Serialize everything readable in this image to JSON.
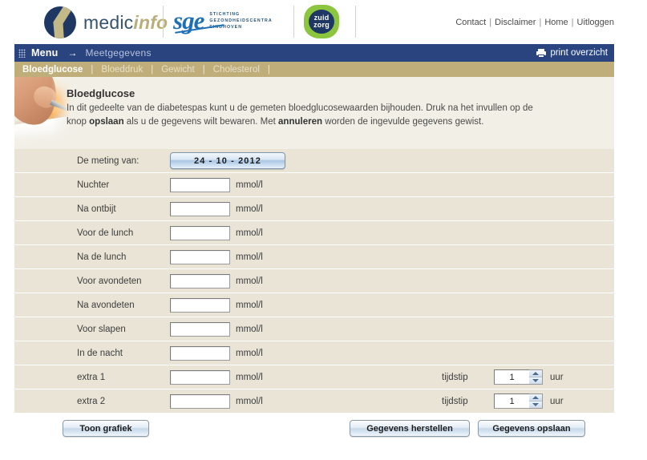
{
  "header": {
    "logos": [
      {
        "name": "medicinfo",
        "text_main": "medic",
        "text_accent": "info"
      },
      {
        "name": "sge",
        "wordmark": "sge",
        "sub_line1": "STICHTING",
        "sub_line2": "GEZONDHEIDSCENTRA",
        "sub_line3": "EINDHOVEN"
      },
      {
        "name": "zuidzorg",
        "line1": "zuid",
        "line2": "zorg"
      }
    ],
    "links": [
      "Contact",
      "Disclaimer",
      "Home",
      "Uitloggen"
    ],
    "link_separator": "|"
  },
  "navbar": {
    "menu_label": "Menu",
    "arrow": "→",
    "breadcrumb": "Meetgegevens",
    "print_label": "print overzicht"
  },
  "tabs": [
    {
      "label": "Bloedglucose",
      "active": true
    },
    {
      "label": "Bloeddruk",
      "active": false
    },
    {
      "label": "Gewicht",
      "active": false
    },
    {
      "label": "Cholesterol",
      "active": false
    }
  ],
  "tab_separator": "|",
  "intro": {
    "title": "Bloedglucose",
    "body_part1": "In dit gedeelte van de diabetespas kunt u de gemeten bloedglucosewaarden bijhouden. Druk na het invullen op de knop ",
    "bold1": "opslaan",
    "body_part2": " als u de gegevens wilt bewaren. Met ",
    "bold2": "annuleren",
    "body_part3": " worden de ingevulde gegevens gewist."
  },
  "date_row": {
    "label": "De meting van:",
    "value": "24 - 10 - 2012"
  },
  "unit": "mmol/l",
  "tijdstip_label": "tijdstip",
  "uur_label": "uur",
  "measurements": [
    {
      "label": "Nuchter",
      "value": "",
      "placeholder": "",
      "has_time": false
    },
    {
      "label": "Na ontbijt",
      "value": "",
      "placeholder": "",
      "has_time": false
    },
    {
      "label": "Voor de lunch",
      "value": "",
      "placeholder": "",
      "has_time": false
    },
    {
      "label": "Na de lunch",
      "value": "",
      "placeholder": "",
      "has_time": false
    },
    {
      "label": "Voor avondeten",
      "value": "",
      "placeholder": "",
      "has_time": false
    },
    {
      "label": "Na avondeten",
      "value": "",
      "placeholder": "",
      "has_time": false
    },
    {
      "label": "Voor slapen",
      "value": "",
      "placeholder": "",
      "has_time": false
    },
    {
      "label": "In de nacht",
      "value": "",
      "placeholder": "",
      "has_time": false
    },
    {
      "label": "extra 1",
      "value": "",
      "placeholder": "",
      "has_time": true,
      "time_value": "1"
    },
    {
      "label": "extra 2",
      "value": "",
      "placeholder": "",
      "has_time": true,
      "time_value": "1"
    }
  ],
  "buttons": {
    "graph": "Toon grafiek",
    "restore": "Gegevens herstellen",
    "save": "Gegevens opslaan"
  },
  "colors": {
    "navy": "#2a4480",
    "tab_gold": "#bfae79",
    "row_beige": "#e9e4d6",
    "intro_bg": "#f2efe6",
    "accent_gold": "#b9ae79",
    "sge_blue": "#1f6fb6",
    "zuidzorg_green": "#8cc63e"
  }
}
